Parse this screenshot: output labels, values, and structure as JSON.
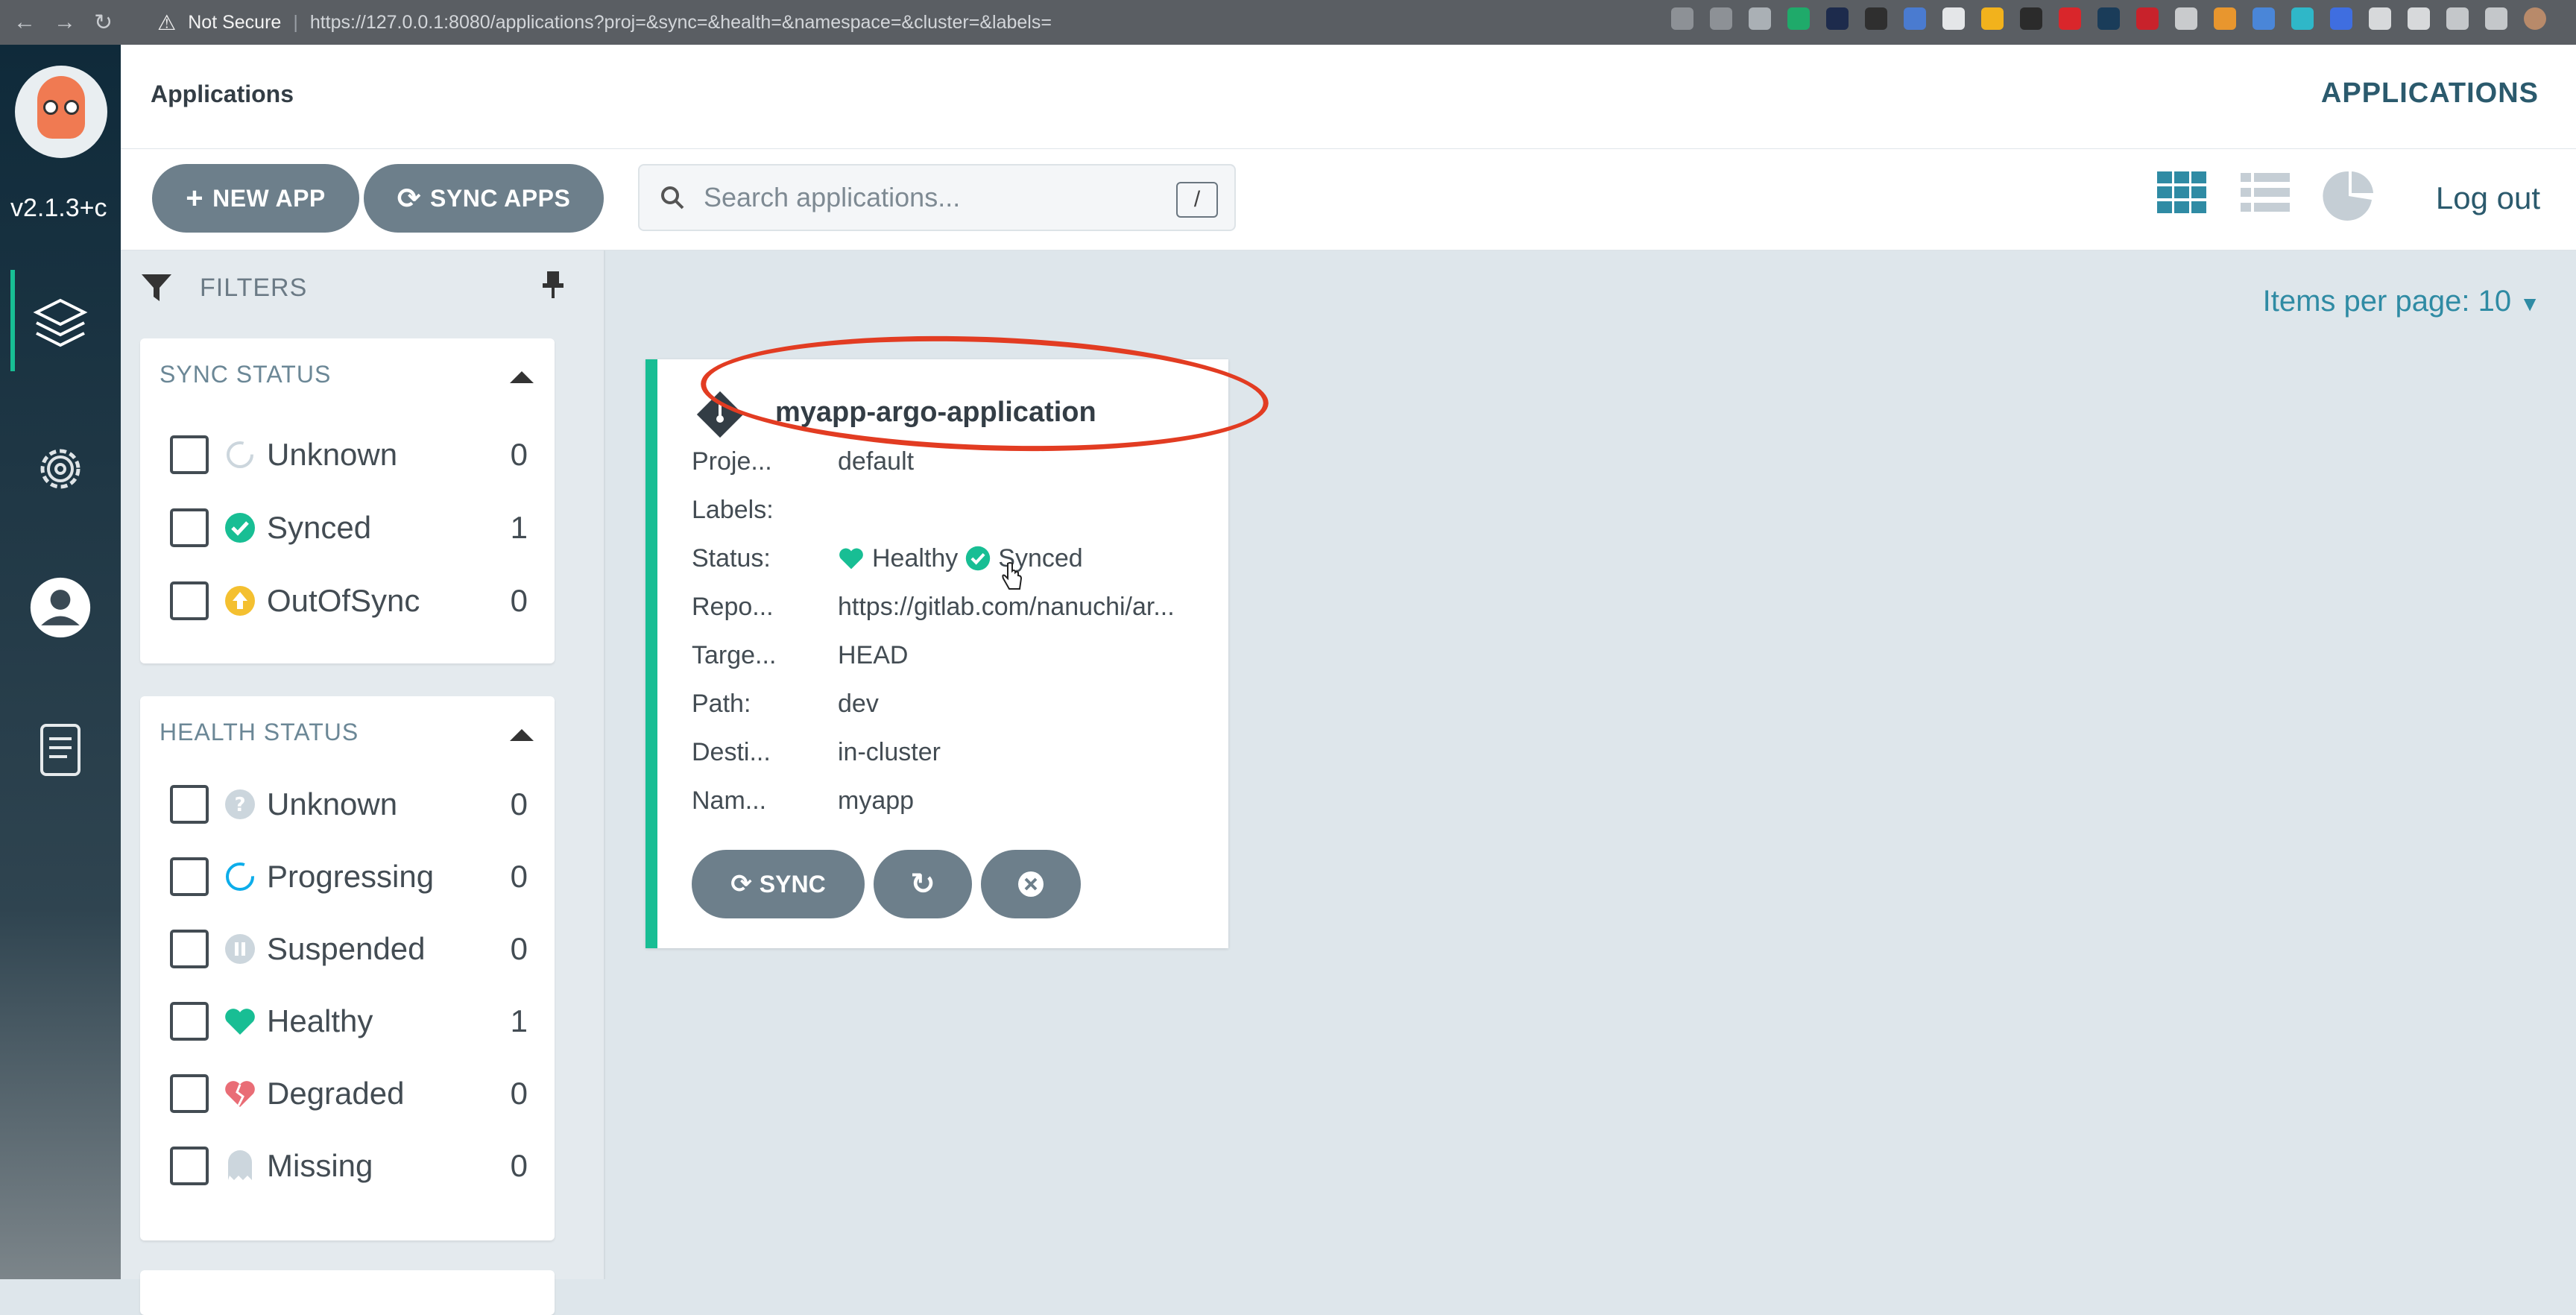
{
  "browser": {
    "security": "Not Secure",
    "url": "https://127.0.0.1:8080/applications?proj=&sync=&health=&namespace=&cluster=&labels="
  },
  "sidebar": {
    "version": "v2.1.3+c"
  },
  "header": {
    "title": "Applications",
    "title_right": "APPLICATIONS"
  },
  "toolbar": {
    "new_app": "NEW APP",
    "sync_apps": "SYNC APPS",
    "search_placeholder": "Search applications...",
    "search_shortcut": "/",
    "logout": "Log out"
  },
  "filters": {
    "label": "FILTERS",
    "sync_status": {
      "title": "SYNC STATUS",
      "items": [
        {
          "label": "Unknown",
          "count": "0"
        },
        {
          "label": "Synced",
          "count": "1"
        },
        {
          "label": "OutOfSync",
          "count": "0"
        }
      ]
    },
    "health_status": {
      "title": "HEALTH STATUS",
      "items": [
        {
          "label": "Unknown",
          "count": "0"
        },
        {
          "label": "Progressing",
          "count": "0"
        },
        {
          "label": "Suspended",
          "count": "0"
        },
        {
          "label": "Healthy",
          "count": "1"
        },
        {
          "label": "Degraded",
          "count": "0"
        },
        {
          "label": "Missing",
          "count": "0"
        }
      ]
    }
  },
  "main": {
    "items_per_page": "Items per page: 10"
  },
  "app_card": {
    "name": "myapp-argo-application",
    "rows": [
      {
        "key": "Proje...",
        "value": "default"
      },
      {
        "key": "Labels:",
        "value": ""
      },
      {
        "key": "Status:",
        "health": "Healthy",
        "sync": "Synced"
      },
      {
        "key": "Repo...",
        "value": "https://gitlab.com/nanuchi/ar..."
      },
      {
        "key": "Targe...",
        "value": "HEAD"
      },
      {
        "key": "Path:",
        "value": "dev"
      },
      {
        "key": "Desti...",
        "value": "in-cluster"
      },
      {
        "key": "Nam...",
        "value": "myapp"
      }
    ],
    "sync_button": "SYNC"
  },
  "colors": {
    "accent_green": "#18be94",
    "button_gray": "#6d7f8b",
    "link_teal": "#2f8ba4",
    "annotation_red": "#e23c22",
    "outofsync_orange": "#f4c030",
    "degraded_red": "#e96d76"
  }
}
